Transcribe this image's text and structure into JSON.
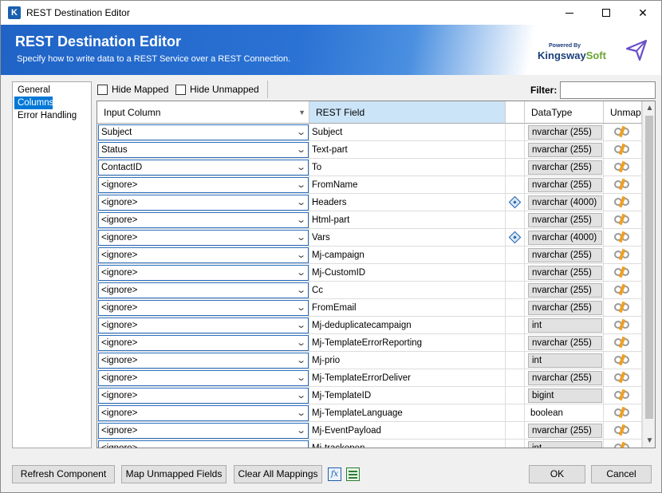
{
  "window": {
    "title": "REST Destination Editor"
  },
  "banner": {
    "title": "REST Destination Editor",
    "subtitle": "Specify how to write data to a REST Service over a REST Connection.",
    "logo_powered": "Powered By",
    "logo_k": "K",
    "logo_ingsway": "ingsway",
    "logo_soft": "Soft"
  },
  "nav": {
    "items": [
      "General",
      "Columns",
      "Error Handling"
    ],
    "selected": "Columns"
  },
  "toolbar": {
    "hide_mapped": "Hide Mapped",
    "hide_unmapped": "Hide Unmapped",
    "filter_label": "Filter:",
    "filter_value": ""
  },
  "grid": {
    "headers": {
      "input": "Input Column",
      "rest": "REST Field",
      "datatype": "DataType",
      "unmap": "Unmap"
    },
    "rows": [
      {
        "input": "Subject",
        "field": "Subject",
        "type": "nvarchar (255)",
        "icon": false,
        "boxed": true
      },
      {
        "input": "Status",
        "field": "Text-part",
        "type": "nvarchar (255)",
        "icon": false,
        "boxed": true
      },
      {
        "input": "ContactID",
        "field": "To",
        "type": "nvarchar (255)",
        "icon": false,
        "boxed": true
      },
      {
        "input": "<ignore>",
        "field": "FromName",
        "type": "nvarchar (255)",
        "icon": false,
        "boxed": true
      },
      {
        "input": "<ignore>",
        "field": "Headers",
        "type": "nvarchar (4000)",
        "icon": true,
        "boxed": true
      },
      {
        "input": "<ignore>",
        "field": "Html-part",
        "type": "nvarchar (255)",
        "icon": false,
        "boxed": true
      },
      {
        "input": "<ignore>",
        "field": "Vars",
        "type": "nvarchar (4000)",
        "icon": true,
        "boxed": true
      },
      {
        "input": "<ignore>",
        "field": "Mj-campaign",
        "type": "nvarchar (255)",
        "icon": false,
        "boxed": true
      },
      {
        "input": "<ignore>",
        "field": "Mj-CustomID",
        "type": "nvarchar (255)",
        "icon": false,
        "boxed": true
      },
      {
        "input": "<ignore>",
        "field": "Cc",
        "type": "nvarchar (255)",
        "icon": false,
        "boxed": true
      },
      {
        "input": "<ignore>",
        "field": "FromEmail",
        "type": "nvarchar (255)",
        "icon": false,
        "boxed": true
      },
      {
        "input": "<ignore>",
        "field": "Mj-deduplicatecampaign",
        "type": "int",
        "icon": false,
        "boxed": true
      },
      {
        "input": "<ignore>",
        "field": "Mj-TemplateErrorReporting",
        "type": "nvarchar (255)",
        "icon": false,
        "boxed": true
      },
      {
        "input": "<ignore>",
        "field": "Mj-prio",
        "type": "int",
        "icon": false,
        "boxed": true
      },
      {
        "input": "<ignore>",
        "field": "Mj-TemplateErrorDeliver",
        "type": "nvarchar (255)",
        "icon": false,
        "boxed": true
      },
      {
        "input": "<ignore>",
        "field": "Mj-TemplateID",
        "type": "bigint",
        "icon": false,
        "boxed": true
      },
      {
        "input": "<ignore>",
        "field": "Mj-TemplateLanguage",
        "type": "boolean",
        "icon": false,
        "boxed": false
      },
      {
        "input": "<ignore>",
        "field": "Mj-EventPayload",
        "type": "nvarchar (255)",
        "icon": false,
        "boxed": true
      },
      {
        "input": "<ignore>",
        "field": "Mj-trackopen",
        "type": "int",
        "icon": false,
        "boxed": true
      }
    ]
  },
  "buttons": {
    "refresh": "Refresh Component",
    "map_unmapped": "Map Unmapped Fields",
    "clear_all": "Clear All Mappings",
    "fx": "fx",
    "ok": "OK",
    "cancel": "Cancel"
  },
  "icons": {
    "app": "kingswaysoft-k-icon",
    "plane": "paper-plane-icon",
    "expression": "fx-icon",
    "excel": "excel-icon",
    "unmap": "unmap-icon",
    "complex_field": "diamond-icon"
  }
}
